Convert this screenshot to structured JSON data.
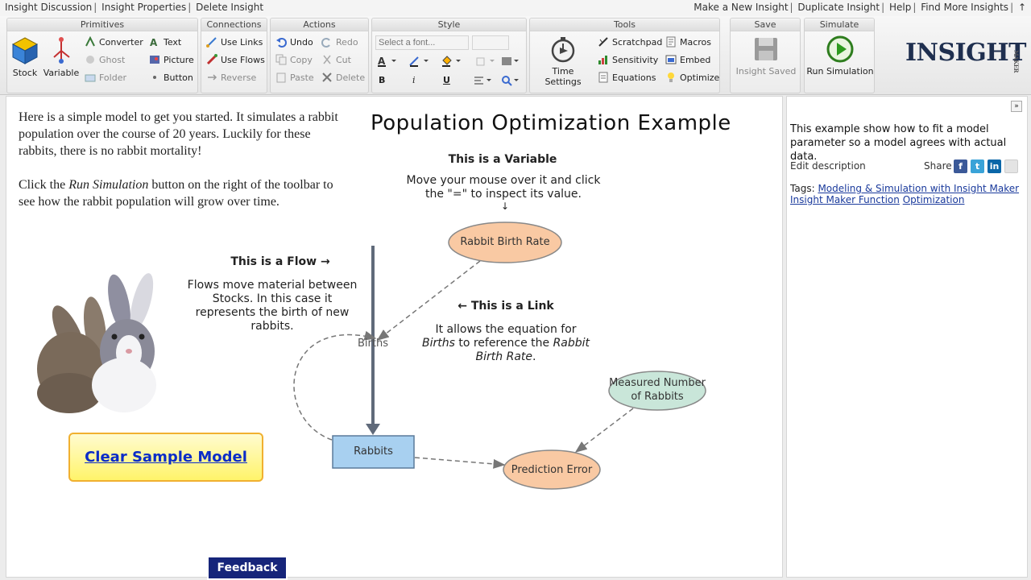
{
  "topbar": {
    "left": [
      "Insight Discussion",
      "Insight Properties",
      "Delete Insight"
    ],
    "right": [
      "Make a New Insight",
      "Duplicate Insight",
      "Help",
      "Find More Insights",
      "↑"
    ]
  },
  "toolbar": {
    "groups": {
      "primitives": "Primitives",
      "connections": "Connections",
      "actions": "Actions",
      "style": "Style",
      "tools": "Tools",
      "save": "Save",
      "simulate": "Simulate"
    },
    "primitives": {
      "stock": "Stock",
      "variable": "Variable",
      "converter": "Converter",
      "ghost": "Ghost",
      "folder": "Folder",
      "text": "Text",
      "picture": "Picture",
      "button": "Button"
    },
    "connections": {
      "use_links": "Use Links",
      "use_flows": "Use Flows",
      "reverse": "Reverse"
    },
    "actions": {
      "undo": "Undo",
      "redo": "Redo",
      "copy": "Copy",
      "cut": "Cut",
      "paste": "Paste",
      "delete": "Delete"
    },
    "style": {
      "font_placeholder": "Select a font...",
      "bold": "B",
      "italic": "i",
      "underline": "U"
    },
    "tools": {
      "time_settings": "Time Settings",
      "scratchpad": "Scratchpad",
      "sensitivity": "Sensitivity",
      "equations": "Equations",
      "macros": "Macros",
      "embed": "Embed",
      "optimize": "Optimize"
    },
    "save": {
      "label": "Insight Saved"
    },
    "simulate": {
      "label": "Run Simulation"
    },
    "logo": "INSIGHT",
    "logo_small": "MAKER"
  },
  "canvas": {
    "intro_p1": "Here is a simple model to get you started. It simulates a rabbit population over the course of 20 years. Luckily for these rabbits, there is no rabbit mortality!",
    "intro_p2_a": "Click the ",
    "intro_p2_em": "Run Simulation",
    "intro_p2_b": " button on the right of the toolbar to see how the rabbit population will grow over time.",
    "title": "Population Optimization Example",
    "variable_heading": "This is a Variable",
    "variable_note": "Move your mouse over it and click the \"=\" to inspect its value.",
    "variable_arrow": "↓",
    "flow_heading": "This is a Flow →",
    "flow_note": "Flows move material between Stocks. In this case it represents the birth of new rabbits.",
    "link_heading": "← This is a Link",
    "link_note_a": "It allows the equation for ",
    "link_note_em1": "Births",
    "link_note_b": " to reference the ",
    "link_note_em2": "Rabbit Birth Rate",
    "link_note_c": ".",
    "nodes": {
      "birth_rate": "Rabbit Birth Rate",
      "births": "Births",
      "rabbits": "Rabbits",
      "measured_1": "Measured Number",
      "measured_2": "of Rabbits",
      "prediction_error": "Prediction Error"
    },
    "clear_button": "Clear Sample Model",
    "feedback": "Feedback"
  },
  "sidepanel": {
    "description": "This example show how to fit a model parameter so a model agrees with actual data.",
    "edit": "Edit description",
    "share": "Share",
    "tags_label": "Tags:",
    "tags": [
      "Modeling & Simulation with Insight Maker",
      "Insight Maker Function",
      "Optimization"
    ]
  },
  "colors": {
    "stock_fill": "#a8d0f0",
    "variable_fill": "#f9c9a3",
    "measured_fill": "#c9e6d9",
    "link": "#777777",
    "flow": "#606a7a"
  }
}
